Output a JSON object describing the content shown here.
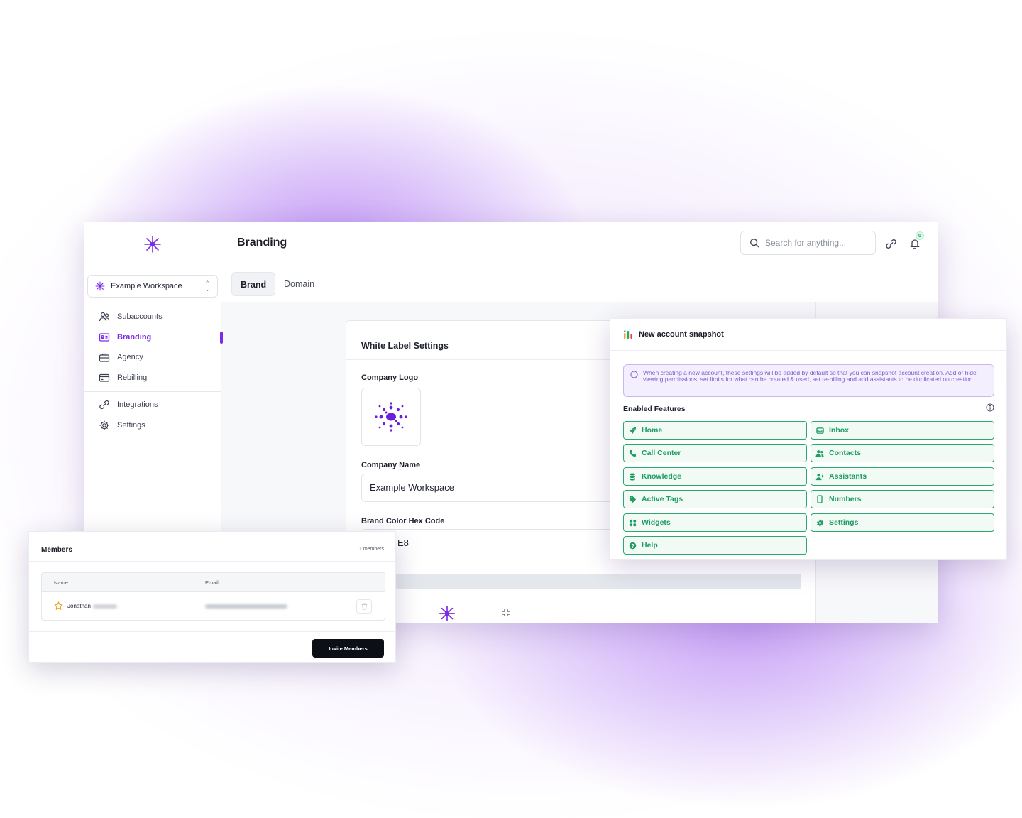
{
  "colors": {
    "brand_purple": "#7c2ae8",
    "feature_green": "#1e9d62",
    "info_purple": "#7c5cc6",
    "invite_button_bg": "#0d0f17"
  },
  "sidebar": {
    "workspace_name": "Example Workspace",
    "items": [
      {
        "label": "Subaccounts",
        "icon": "users-icon"
      },
      {
        "label": "Branding",
        "icon": "id-card-icon",
        "active": true
      },
      {
        "label": "Agency",
        "icon": "briefcase-icon"
      },
      {
        "label": "Rebilling",
        "icon": "credit-card-icon"
      }
    ],
    "items2": [
      {
        "label": "Integrations",
        "icon": "link-icon"
      },
      {
        "label": "Settings",
        "icon": "gear-icon"
      }
    ]
  },
  "header": {
    "title": "Branding",
    "search_placeholder": "Search for anything...",
    "notification_count": "0"
  },
  "tabs": [
    {
      "label": "Brand",
      "active": true
    },
    {
      "label": "Domain"
    }
  ],
  "white_label": {
    "title": "White Label Settings",
    "company_logo_label": "Company Logo",
    "company_name_label": "Company Name",
    "company_name_value": "Example Workspace",
    "brand_color_label": "Brand Color Hex Code",
    "brand_color_value_visible": "E8"
  },
  "snapshot": {
    "title": "New account snapshot",
    "info_text": "When creating a new account, these settings will be added by default so that you can snapshot account creation. Add or hide viewing permissions, set limits for what can be created & used, set re-billing and add assistants to be duplicated on creation.",
    "features_label": "Enabled Features",
    "features": [
      {
        "label": "Home",
        "icon": "rocket-icon"
      },
      {
        "label": "Inbox",
        "icon": "inbox-icon"
      },
      {
        "label": "Call Center",
        "icon": "phone-icon"
      },
      {
        "label": "Contacts",
        "icon": "contacts-icon"
      },
      {
        "label": "Knowledge",
        "icon": "database-icon"
      },
      {
        "label": "Assistants",
        "icon": "user-plus-icon"
      },
      {
        "label": "Active Tags",
        "icon": "tag-icon"
      },
      {
        "label": "Numbers",
        "icon": "mobile-icon"
      },
      {
        "label": "Widgets",
        "icon": "widgets-icon"
      },
      {
        "label": "Settings",
        "icon": "gear-icon"
      },
      {
        "label": "Help",
        "icon": "help-icon"
      }
    ]
  },
  "members": {
    "title": "Members",
    "count": "1 members",
    "columns": [
      "Name",
      "Email"
    ],
    "rows": [
      {
        "name_visible": "Jonathan"
      }
    ],
    "invite_label": "Invite Members"
  }
}
